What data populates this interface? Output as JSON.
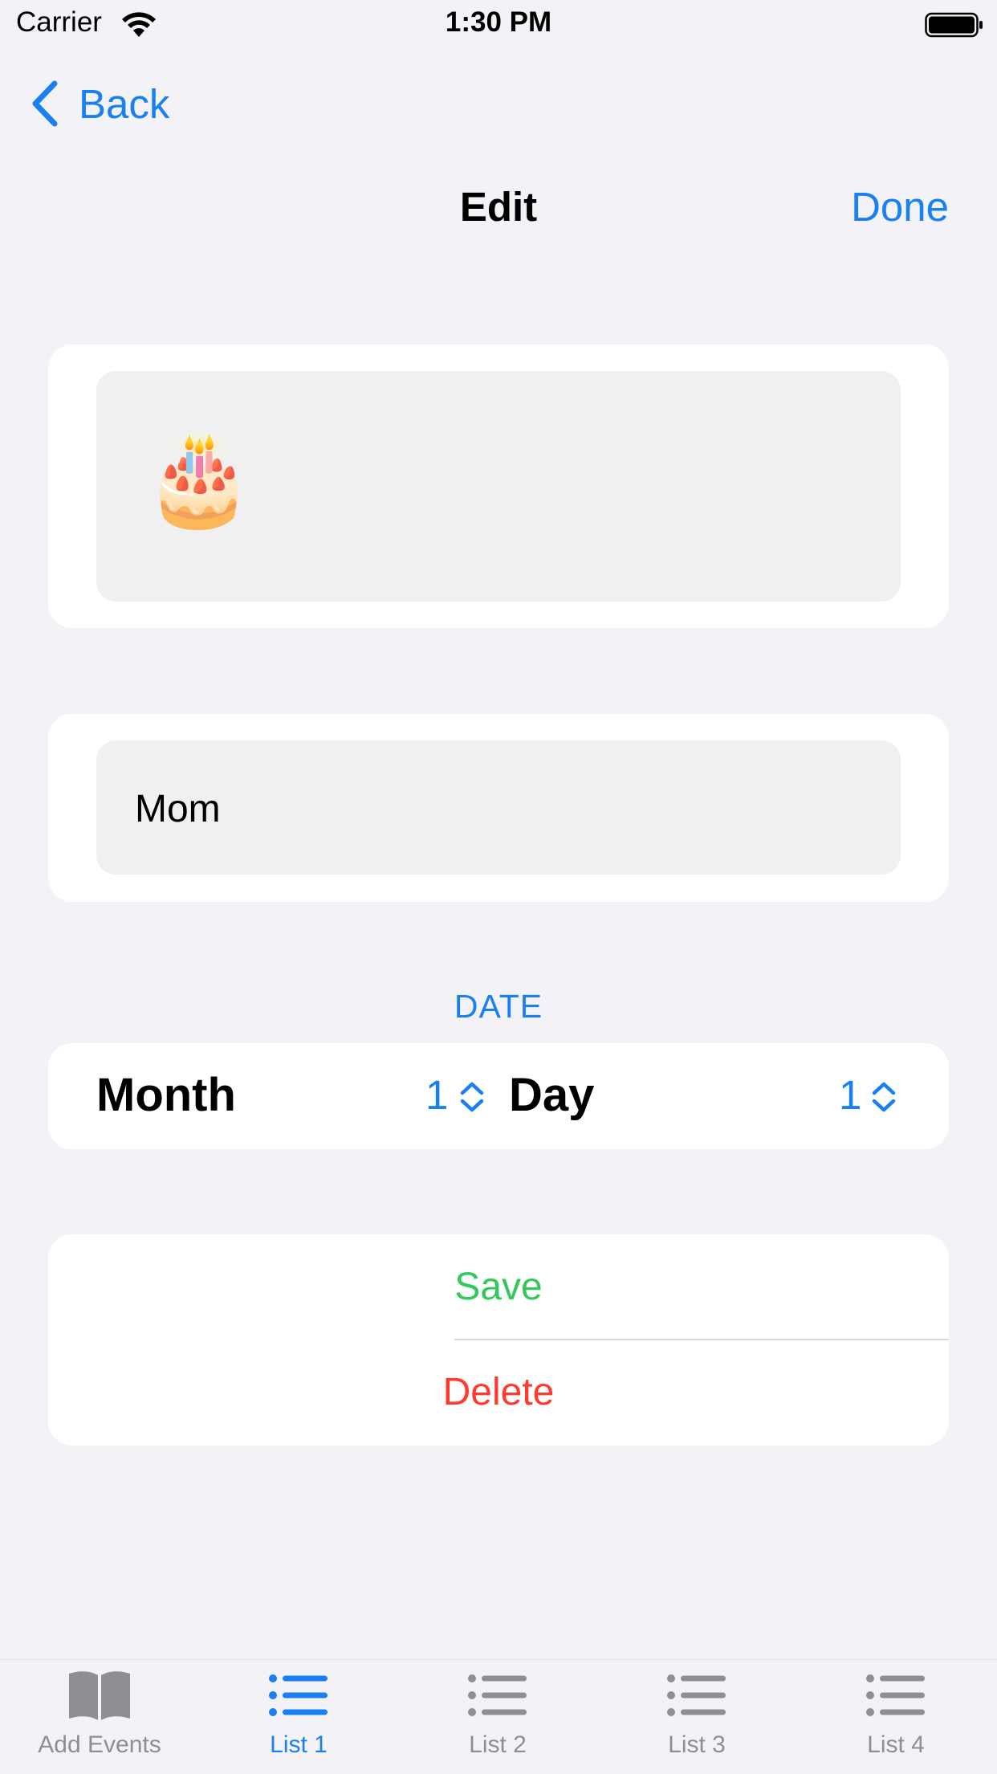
{
  "status_bar": {
    "carrier": "Carrier",
    "time": "1:30 PM"
  },
  "nav": {
    "back_label": "Back",
    "title": "Edit",
    "done_label": "Done"
  },
  "form": {
    "emoji_value": "🎂",
    "name_value": "Mom",
    "date_header": "DATE",
    "month_label": "Month",
    "month_value": "1",
    "day_label": "Day",
    "day_value": "1"
  },
  "actions": {
    "save_label": "Save",
    "delete_label": "Delete"
  },
  "tabs": [
    {
      "label": "Add Events",
      "icon": "book-icon",
      "active": false
    },
    {
      "label": "List 1",
      "icon": "list-icon",
      "active": true
    },
    {
      "label": "List 2",
      "icon": "list-icon",
      "active": false
    },
    {
      "label": "List 3",
      "icon": "list-icon",
      "active": false
    },
    {
      "label": "List 4",
      "icon": "list-icon",
      "active": false
    }
  ],
  "colors": {
    "accent": "#1a7ff0",
    "save": "#34c759",
    "delete": "#ff3b30",
    "background": "#f2f2f7"
  }
}
